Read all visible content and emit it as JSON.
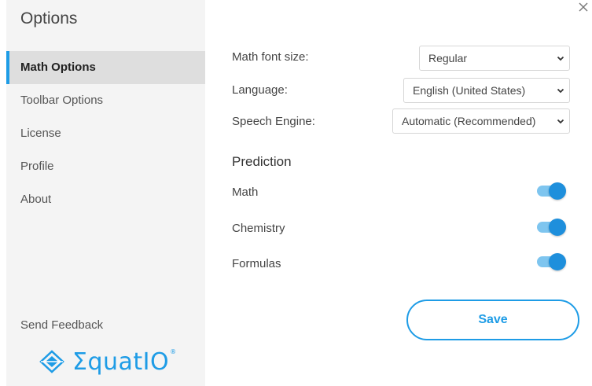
{
  "sidebar": {
    "title": "Options",
    "items": [
      {
        "label": "Math Options",
        "active": true
      },
      {
        "label": "Toolbar Options"
      },
      {
        "label": "License"
      },
      {
        "label": "Profile"
      },
      {
        "label": "About"
      }
    ],
    "feedback_label": "Send Feedback",
    "logo_text": "ΣquatIO",
    "logo_mark": "®"
  },
  "form": {
    "font_size": {
      "label": "Math font size:",
      "value": "Regular"
    },
    "language": {
      "label": "Language:",
      "value": "English (United States)"
    },
    "speech": {
      "label": "Speech Engine:",
      "value": "Automatic (Recommended)"
    }
  },
  "prediction": {
    "heading": "Prediction",
    "toggles": [
      {
        "label": "Math",
        "on": true
      },
      {
        "label": "Chemistry",
        "on": true
      },
      {
        "label": "Formulas",
        "on": true
      }
    ]
  },
  "actions": {
    "save_label": "Save"
  },
  "colors": {
    "accent": "#1e9ce6",
    "toggle_track": "#7ec5ef",
    "sidebar_bg": "#f4f4f4",
    "active_bg": "#dedede"
  }
}
